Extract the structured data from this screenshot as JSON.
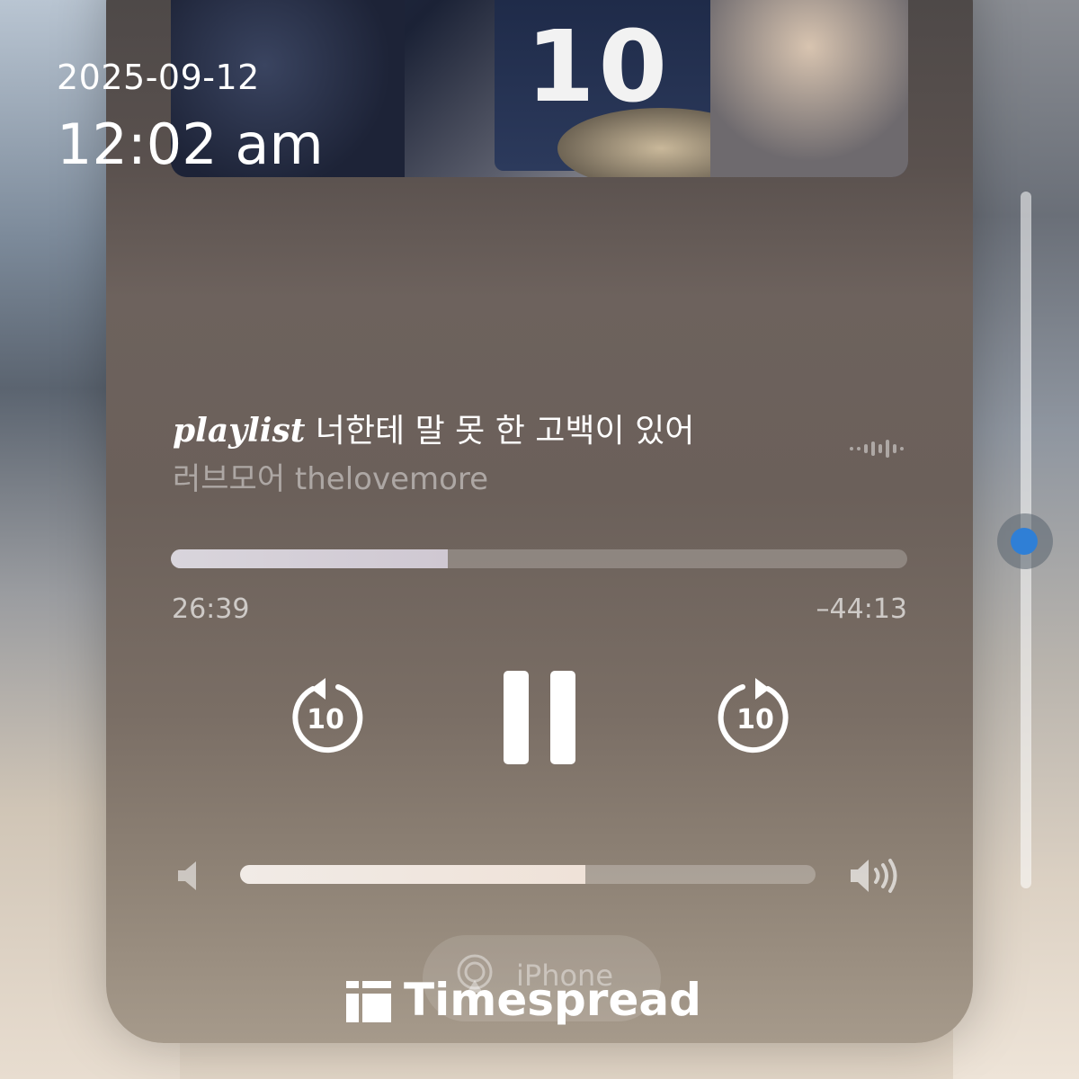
{
  "status": {
    "date": "2025-09-12",
    "time": "12:02 am"
  },
  "now_playing": {
    "title_prefix": "playlist",
    "title_main": "너한테 말 못 한 고백이 있어",
    "artist": "러브모어 thelovemore",
    "elapsed": "26:39",
    "remaining": "–44:13",
    "progress_fraction": 0.376
  },
  "controls": {
    "skip_back_seconds": "10",
    "skip_forward_seconds": "10",
    "state": "playing",
    "icons": [
      "skip-back-10-icon",
      "pause-icon",
      "skip-forward-10-icon"
    ]
  },
  "volume": {
    "level_fraction": 0.6,
    "icons": [
      "volume-low-icon",
      "volume-high-icon"
    ]
  },
  "output": {
    "device_label": "iPhone",
    "icon": "airplay-icon"
  },
  "side_slider": {
    "level_fraction": 0.48
  },
  "watermark": {
    "brand": "Timespread"
  },
  "colors": {
    "accent": "#2f7fd6",
    "text": "#ffffff"
  }
}
